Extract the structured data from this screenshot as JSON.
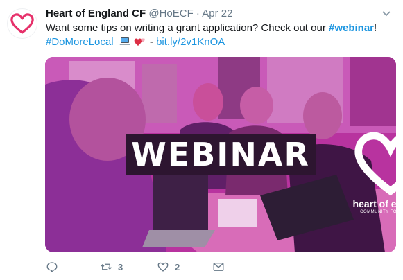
{
  "account": {
    "name": "Heart of England CF",
    "handle": "@HoECF",
    "separator": "·",
    "time": "Apr 22"
  },
  "tweet": {
    "text_before": "Want some tips on writing a grant application? Check out our ",
    "hashtag_webinar": "#webinar",
    "text_after": "!",
    "hashtag_local": "#DoMoreLocal",
    "emojis": [
      "laptop-emoji",
      "heart-emoji",
      "heart-emoji"
    ],
    "link_dash": " - ",
    "link": "bit.ly/2v1KnOA"
  },
  "media": {
    "banner_text": "WEBINAR",
    "brand_name": "heart of england",
    "brand_sub": "COMMUNITY FOUNDATION",
    "overlay_color": "#c63db0"
  },
  "actions": {
    "reply_icon": "reply-icon",
    "retweet_count": "3",
    "like_count": "2",
    "dm_icon": "envelope-icon"
  },
  "colors": {
    "link": "#1b95e0",
    "muted": "#657786",
    "brand_heart": "#e6306a"
  }
}
